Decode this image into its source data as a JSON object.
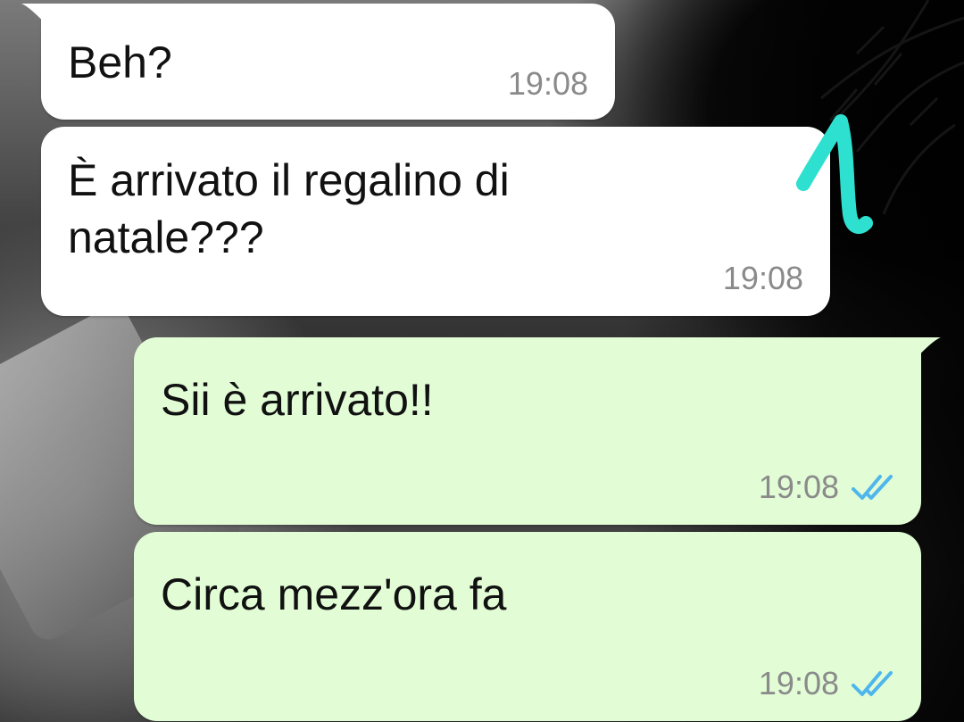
{
  "colors": {
    "incoming_bubble": "#ffffff",
    "outgoing_bubble": "#e2fdd6",
    "time_text": "#8a8a8a",
    "read_ticks": "#4fb6ec",
    "annotation": "#2ee0d0"
  },
  "annotation": {
    "icon": "hand-drawn-number-one",
    "text": "1"
  },
  "messages": [
    {
      "direction": "incoming",
      "text": "Beh?",
      "time": "19:08"
    },
    {
      "direction": "incoming",
      "text": "È arrivato il regalino di\nnatale???",
      "time": "19:08"
    },
    {
      "direction": "outgoing",
      "text": "Sii è arrivato!!",
      "time": "19:08",
      "status_icon": "double-check-read-icon"
    },
    {
      "direction": "outgoing",
      "text": "Circa mezz'ora fa",
      "time": "19:08",
      "status_icon": "double-check-read-icon"
    }
  ]
}
